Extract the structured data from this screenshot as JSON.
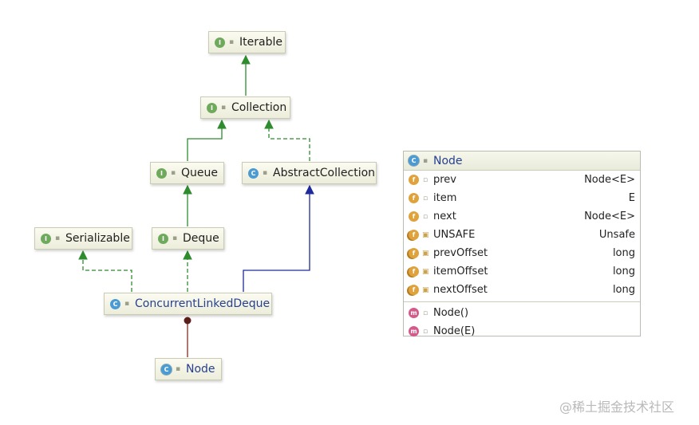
{
  "diagram": {
    "nodes": {
      "iterable": {
        "badge": "I",
        "label": "Iterable"
      },
      "collection": {
        "badge": "I",
        "label": "Collection"
      },
      "queue": {
        "badge": "I",
        "label": "Queue"
      },
      "abstract_collection": {
        "badge": "C",
        "label": "AbstractCollection"
      },
      "serializable": {
        "badge": "I",
        "label": "Serializable"
      },
      "deque": {
        "badge": "I",
        "label": "Deque"
      },
      "concurrent_linked_deque": {
        "badge": "C",
        "label": "ConcurrentLinkedDeque"
      },
      "node": {
        "badge": "C",
        "label": "Node"
      }
    },
    "edge_colors": {
      "extends_interface": "#2e8b2e",
      "implements": "#2e8b2e",
      "extends_class": "#1e2a9c",
      "inner": "#8b3a2e"
    }
  },
  "panel": {
    "title": "Node",
    "title_badge": "C",
    "fields": [
      {
        "badge": "f",
        "name": "prev",
        "type": "Node<E>"
      },
      {
        "badge": "f",
        "name": "item",
        "type": "E"
      },
      {
        "badge": "f",
        "name": "next",
        "type": "Node<E>"
      },
      {
        "badge": "f",
        "name": "UNSAFE",
        "type": "Unsafe"
      },
      {
        "badge": "f",
        "name": "prevOffset",
        "type": "long"
      },
      {
        "badge": "f",
        "name": "itemOffset",
        "type": "long"
      },
      {
        "badge": "f",
        "name": "nextOffset",
        "type": "long"
      }
    ],
    "methods": [
      {
        "badge": "m",
        "name": "Node()"
      },
      {
        "badge": "m",
        "name": "Node(E)"
      }
    ]
  },
  "watermark": "@稀土掘金技术社区"
}
